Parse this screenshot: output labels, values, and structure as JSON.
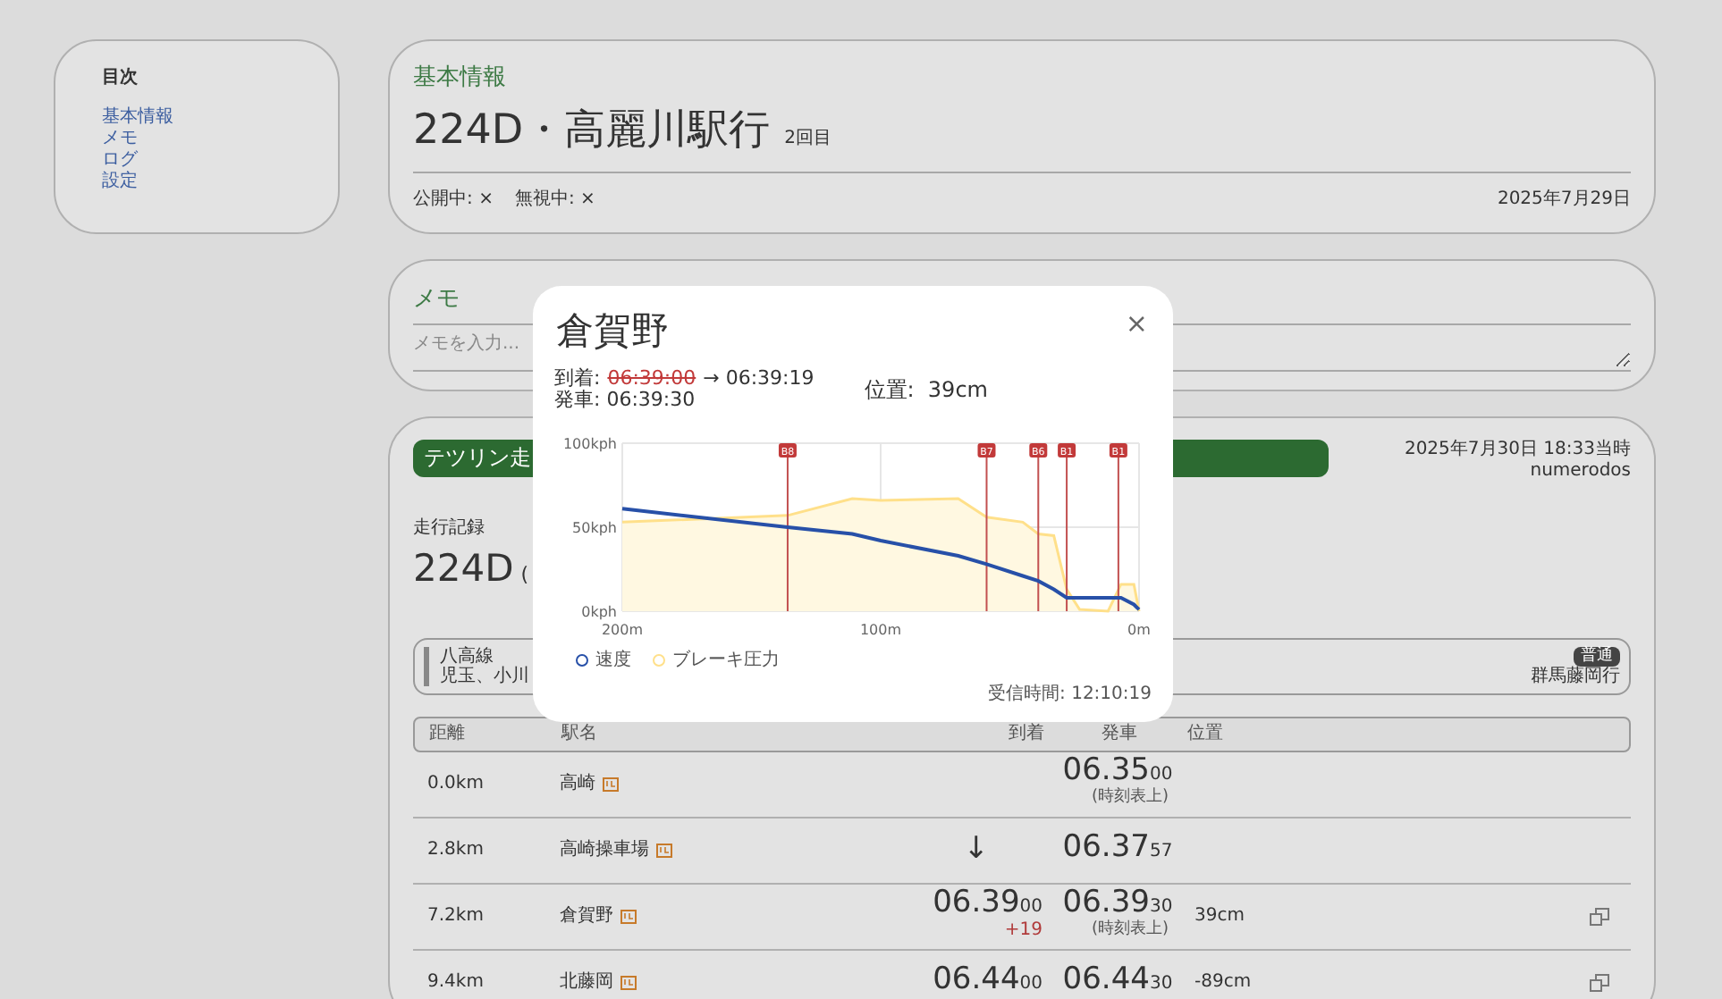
{
  "toc": {
    "title": "目次",
    "items": [
      "基本情報",
      "メモ",
      "ログ",
      "設定"
    ]
  },
  "basic": {
    "heading": "基本情報",
    "title": "224D・高麗川駅行",
    "title_note": "2回目",
    "flags": [
      {
        "label": "公開中:",
        "value": "×"
      },
      {
        "label": "無視中:",
        "value": "×"
      }
    ],
    "date": "2025年7月29日"
  },
  "memo": {
    "heading": "メモ",
    "placeholder": "メモを入力..."
  },
  "log": {
    "banner": "テツリン走",
    "timestamp": "2025年7月30日 18:33当時",
    "user": "numerodos",
    "record_label": "走行記録",
    "record_title": "224D",
    "record_note": "(",
    "line": {
      "name": "八高線",
      "via": "児玉、小川",
      "type": "普通",
      "destination": "群馬藤岡行"
    },
    "columns": [
      "距離",
      "駅名",
      "到着",
      "発車",
      "位置"
    ],
    "rows": [
      {
        "distance": "0.0km",
        "station": "高崎",
        "arrival": "",
        "arrival_sec": "",
        "delta": "",
        "departure": "06.35",
        "departure_sec": "00",
        "departure_note": "(時刻表上)",
        "position": "",
        "detail": false
      },
      {
        "distance": "2.8km",
        "station": "高崎操車場",
        "arrival": "↓",
        "arrival_sec": "",
        "delta": "",
        "departure": "06.37",
        "departure_sec": "57",
        "departure_note": "",
        "position": "",
        "detail": false
      },
      {
        "distance": "7.2km",
        "station": "倉賀野",
        "arrival": "06.39",
        "arrival_sec": "00",
        "delta": "+19",
        "color": "#b03a3a",
        "departure": "06.39",
        "departure_sec": "30",
        "departure_note": "(時刻表上)",
        "position": "39cm",
        "detail": true
      },
      {
        "distance": "9.4km",
        "station": "北藤岡",
        "arrival": "06.44",
        "arrival_sec": "00",
        "delta": "",
        "departure": "06.44",
        "departure_sec": "30",
        "departure_note": "",
        "position": "-89cm",
        "detail": true
      }
    ]
  },
  "modal": {
    "title": "倉賀野",
    "close": "×",
    "arrival_label": "到着:",
    "arrival_planned": "06:39:00",
    "arrival_actual": "→ 06:39:19",
    "departure": "発車: 06:39:30",
    "position": "位置:  39cm",
    "received": "受信時間: 12:10:19",
    "chart_data": {
      "type": "line",
      "x": [
        200,
        136,
        111,
        100,
        70,
        59,
        45,
        39,
        33,
        28,
        23,
        12,
        7,
        2,
        0
      ],
      "xlim": [
        200,
        0
      ],
      "ylim": [
        0,
        100
      ],
      "xticks": [
        {
          "value": 200,
          "label": "200m"
        },
        {
          "value": 100,
          "label": "100m"
        },
        {
          "value": 0,
          "label": "0m"
        }
      ],
      "yticks": [
        {
          "value": 100,
          "label": "100kph"
        },
        {
          "value": 50,
          "label": "50kph"
        },
        {
          "value": 0,
          "label": "0kph"
        }
      ],
      "series": [
        {
          "name": "速度",
          "color": "#2750a8",
          "values": [
            61,
            50,
            46,
            42,
            33,
            28,
            21,
            18,
            13,
            8,
            8,
            8,
            8,
            4,
            1
          ]
        },
        {
          "name": "ブレーキ圧力",
          "color": "#ffe08a",
          "values": [
            53,
            57,
            67,
            66,
            67,
            56,
            53,
            46,
            45,
            13,
            1,
            0,
            16,
            16,
            0
          ]
        }
      ],
      "legend": "bottom",
      "ref_lines": [
        {
          "axis": "x",
          "value": 136,
          "label": "B8"
        },
        {
          "axis": "x",
          "value": 59,
          "label": "B7"
        },
        {
          "axis": "x",
          "value": 39,
          "label": "B6"
        },
        {
          "axis": "x",
          "value": 28,
          "label": "B1"
        },
        {
          "axis": "x",
          "value": 8,
          "label": "B1"
        }
      ]
    }
  }
}
